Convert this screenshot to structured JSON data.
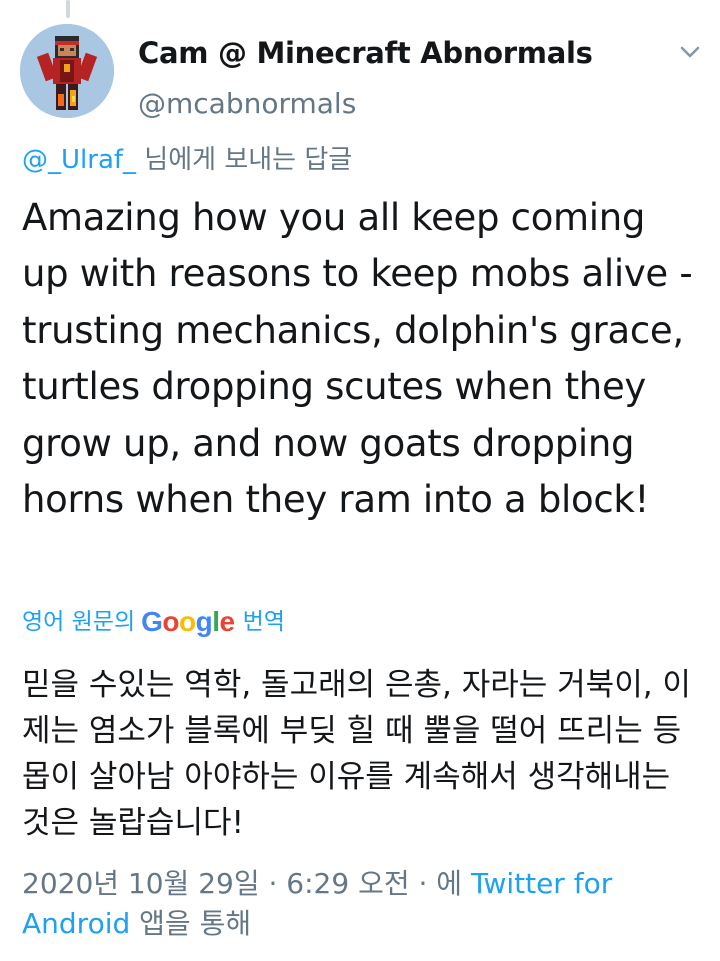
{
  "author": {
    "display_name": "Cam @ Minecraft Abnormals",
    "handle": "@mcabnormals"
  },
  "reply_context": {
    "mention": "@_Ulraf_",
    "suffix": " 님에게 보내는 답글"
  },
  "tweet": {
    "text": "Amazing how you all keep coming up with reasons to keep mobs alive - trusting mechanics, dolphin's grace, turtles dropping scutes when they grow up, and now goats dropping horns when they ram into a block!"
  },
  "translation": {
    "prefix": "영어 원문의",
    "brand": "Google",
    "suffix": "번역",
    "text": "믿을 수있는 역학, 돌고래의 은총, 자라는 거북이, 이제는 염소가 블록에 부딪 힐 때 뿔을 떨어 뜨리는 등 몹이 살아남 아야하는 이유를 계속해서 생각해내는 것은 놀랍습니다!"
  },
  "meta": {
    "timestamp": "2020년 10월 29일 · 6:29 오전 · 에",
    "source": "Twitter for Android",
    "suffix": "앱을 통해"
  },
  "icons": {
    "caret": "chevron-down-icon"
  },
  "colors": {
    "link": "#1da1f2",
    "secondary": "#657786",
    "text": "#14171a",
    "google_blue": "#4285f4",
    "google_red": "#ea4335",
    "google_yellow": "#fbbc05",
    "google_green": "#34a853"
  }
}
